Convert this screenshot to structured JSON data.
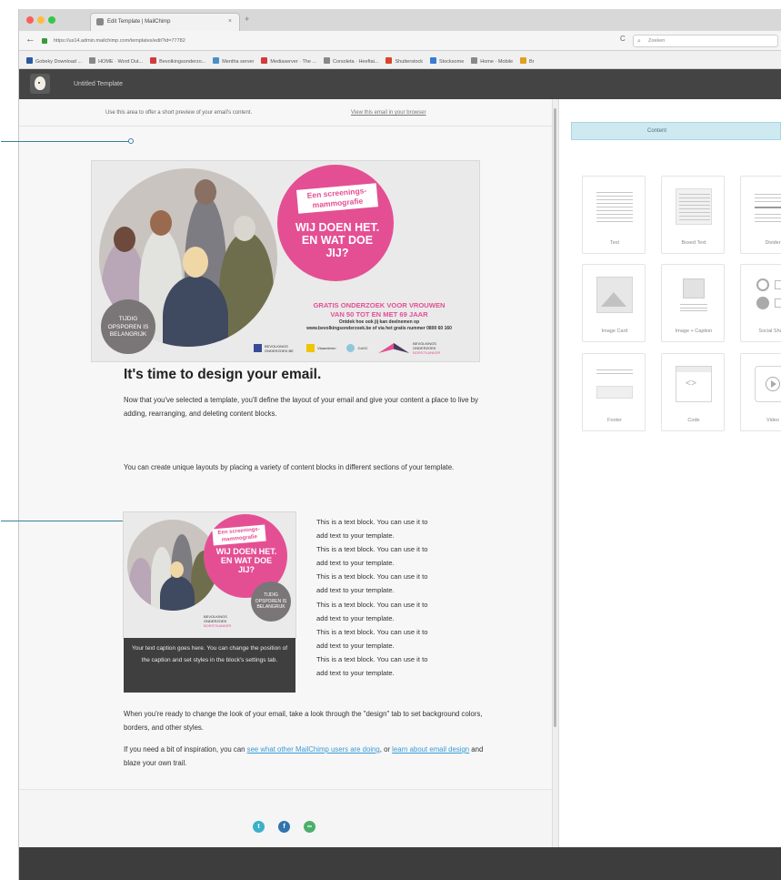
{
  "browser": {
    "tab_title": "Edit Template | MailChimp",
    "tab_close": "×",
    "new_tab": "+",
    "back": "←",
    "url": "https://us14.admin.mailchimp.com/templates/edit?id=77782",
    "reload": "C",
    "search_placeholder": "Zoeken",
    "search_icon": "⌕",
    "bookmarks": [
      {
        "label": "Gobeky Download ...",
        "color": "#2c5aa0"
      },
      {
        "label": "HOME · Word Dut...",
        "color": "#888888"
      },
      {
        "label": "Bevolkingsonderzo...",
        "color": "#d23b3b"
      },
      {
        "label": "Mentha server",
        "color": "#4a90c8"
      },
      {
        "label": "Mediaserver · The ...",
        "color": "#d23b3b"
      },
      {
        "label": "Corsoleta · Heeftai...",
        "color": "#888888"
      },
      {
        "label": "Shutterstock",
        "color": "#d8452b"
      },
      {
        "label": "Stocksome",
        "color": "#3a7bd5"
      },
      {
        "label": "Home · Mobile",
        "color": "#888888"
      },
      {
        "label": "Br",
        "color": "#e0a020"
      }
    ]
  },
  "app": {
    "title": "Untitled Template"
  },
  "canvas": {
    "preheader_text": "Use this area to offer a short preview of your email's content.",
    "view_in_browser": "View this email in your browser",
    "headline": "It's time to design your email.",
    "paragraph1": "Now that you've selected a template, you'll define the layout of your email and give your content a place to live by adding, rearranging, and deleting content blocks.",
    "paragraph2": "You can create unique layouts by placing a variety of content blocks in different sections of your template.",
    "caption": "Your text caption goes here. You can change the position of the caption and set styles in the block's settings tab.",
    "text_block_lines": [
      "This is a text block. You can use it to",
      "add text to your template.",
      "This is a text block. You can use it to",
      "add text to your template.",
      "This is a text block. You can use it to",
      "add text to your template.",
      "This is a text block. You can use it to",
      "add text to your template.",
      "This is a text block. You can use it to",
      "add text to your template.",
      "This is a text block. You can use it to",
      "add text to your template."
    ],
    "paragraph3": "When you're ready to change the look of your email, take a look through the \"design\" tab to set background colors, borders, and other styles.",
    "paragraph4_start": "If you need a bit of inspiration, you can ",
    "paragraph4_link1": "see what other MailChimp users are doing",
    "paragraph4_mid": ", or ",
    "paragraph4_link2": "learn about email design",
    "paragraph4_end": " and blaze your own trail."
  },
  "banner": {
    "tag_line1": "Een screenings-",
    "tag_line2": "mammografie",
    "slogan_line1": "WIJ DOEN HET.",
    "slogan_line2": "EN WAT DOE",
    "slogan_line3": "JIJ?",
    "badge_line1": "TIJDIG",
    "badge_line2": "OPSPOREN IS",
    "badge_line3": "BELANGRIJK",
    "offer_line1": "GRATIS ONDERZOEK VOOR VROUWEN",
    "offer_line2": "VAN 50 TOT EN MET 69 JAAR",
    "info_line1": "Ontdek hoe ook jij kan deelnemen op",
    "info_line2": "www.bevolkingsonderzoek.be of via het gratis nummer 0800 60 160",
    "logo1": "BEVOLKINGS ONDERZOEK.BE",
    "logo2": "Vlaanderen",
    "logo3": "CvKO",
    "logo4_line1": "BEVOLKINGS",
    "logo4_line2": "ONDERZOEK",
    "logo4_line3": "BORSTKANKER",
    "pink": "#e44f94",
    "grey_badge": "#7a7677"
  },
  "panel": {
    "tab_label": "Content",
    "blocks": [
      {
        "label": "Text",
        "icon": "text-icon"
      },
      {
        "label": "Boxed Text",
        "icon": "boxed-text-icon"
      },
      {
        "label": "Divider",
        "icon": "divider-icon"
      },
      {
        "label": "Image Card",
        "icon": "image-card-icon"
      },
      {
        "label": "Image + Caption",
        "icon": "image-caption-icon"
      },
      {
        "label": "Social Share",
        "icon": "social-share-icon"
      },
      {
        "label": "Footer",
        "icon": "footer-icon"
      },
      {
        "label": "Code",
        "icon": "code-icon"
      },
      {
        "label": "Video",
        "icon": "video-icon"
      }
    ]
  },
  "footer": {
    "social": [
      {
        "name": "twitter-icon",
        "glyph": "t",
        "color": "#3bb1c9"
      },
      {
        "name": "facebook-icon",
        "glyph": "f",
        "color": "#2f74ad"
      },
      {
        "name": "link-icon",
        "glyph": "∞",
        "color": "#4cae6c"
      }
    ]
  },
  "colors": {
    "accent": "#3a9bd6",
    "header_bg": "#444445",
    "panel_tab_bg": "#cfe9f1"
  }
}
